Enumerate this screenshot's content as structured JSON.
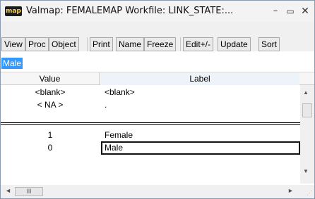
{
  "window": {
    "icon_text": "map",
    "title": "Valmap: FEMALEMAP   Workfile: LINK_STATE:...",
    "minimize_glyph": "–",
    "maximize_glyph": "▭",
    "close_glyph": "✕"
  },
  "toolbar": {
    "buttons": [
      "View",
      "Proc",
      "Object",
      "Print",
      "Name",
      "Freeze",
      "Edit+/-",
      "Update",
      "Sort"
    ]
  },
  "edit_line": {
    "value": "Male"
  },
  "grid": {
    "headers": {
      "value": "Value",
      "label": "Label"
    },
    "special_rows": [
      {
        "value": "<blank>",
        "label": "<blank>"
      },
      {
        "value": "< NA >",
        "label": "."
      }
    ],
    "rows": [
      {
        "value": "1",
        "label": "Female"
      },
      {
        "value": "0",
        "label": "Male"
      }
    ]
  },
  "scrollbars": {
    "up_icon": "▲",
    "down_icon": "▼",
    "left_icon": "◄",
    "right_icon": "►",
    "thumb_grip": "III"
  }
}
